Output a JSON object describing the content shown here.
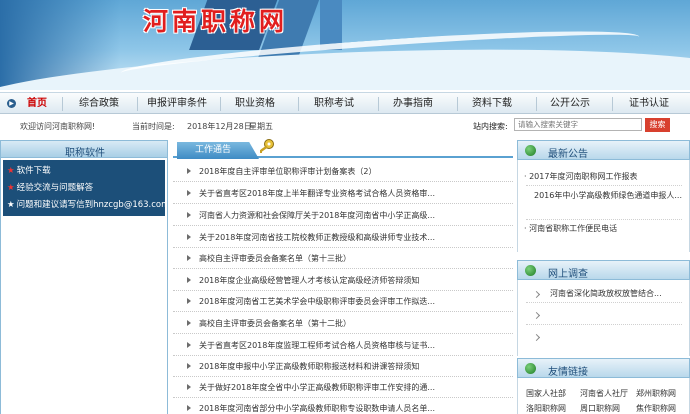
{
  "header": {
    "site_title": "河南职称网"
  },
  "nav": {
    "items": [
      "首页",
      "综合政策",
      "申报评审条件",
      "职业资格",
      "职称考试",
      "办事指南",
      "资料下载",
      "公开公示",
      "证书认证"
    ]
  },
  "infobar": {
    "welcome": "欢迎访问河南职称网!",
    "time_label": "当前时间是:",
    "date": "2018年12月28日",
    "weekday": "星期五",
    "search_label": "站内搜索:",
    "search_placeholder": "请输入搜索关键字",
    "search_button": "搜索"
  },
  "left_panel": {
    "title": "职称软件",
    "links": [
      "软件下载",
      "经验交流与问题解答",
      "问题和建议请写信到hnzcgb@163.com"
    ]
  },
  "center": {
    "tab_title": "工作通告",
    "items": [
      "2018年度自主评审单位职称评审计划备案表（2）",
      "关于省直考区2018年度上半年翻译专业资格考试合格人员资格审...",
      "河南省人力资源和社会保障厅关于2018年度河南省中小学正高级...",
      "关于2018年度河南省技工院校教师正教授级和高级讲师专业技术...",
      "高校自主评审委员会备案名单（第十三批）",
      "2018年度企业高级经营管理人才考核认定高级经济师答辩须知",
      "2018年度河南省工艺美术学会中级职称评审委员会评审工作拟迭...",
      "高校自主评审委员会备案名单（第十二批）",
      "关于省直考区2018年度监理工程师考试合格人员资格审核与证书...",
      "2018年度申报中小学正高级教师职称报送材料和讲课答辩须知",
      "关于做好2018年度全省中小学正高级教师职称评审工作安排的通...",
      "2018年度河南省部分中小学高级教师职称专设职数申请人员名单..."
    ]
  },
  "right": {
    "news": {
      "title": "最新公告",
      "items": [
        "2017年度河南职称网工作报表",
        "2016年中小学高级教师绿色通道申报人...",
        "河南省职称工作便民电话"
      ]
    },
    "survey": {
      "title": "网上调查",
      "items": [
        "河南省深化简政放权放管结合..."
      ]
    },
    "links": {
      "title": "友情链接",
      "row1": [
        "国家人社部",
        "河南省人社厅",
        "郑州职称网"
      ],
      "row2": [
        "洛阳职称网",
        "周口职称网",
        "焦作职称网"
      ]
    }
  }
}
